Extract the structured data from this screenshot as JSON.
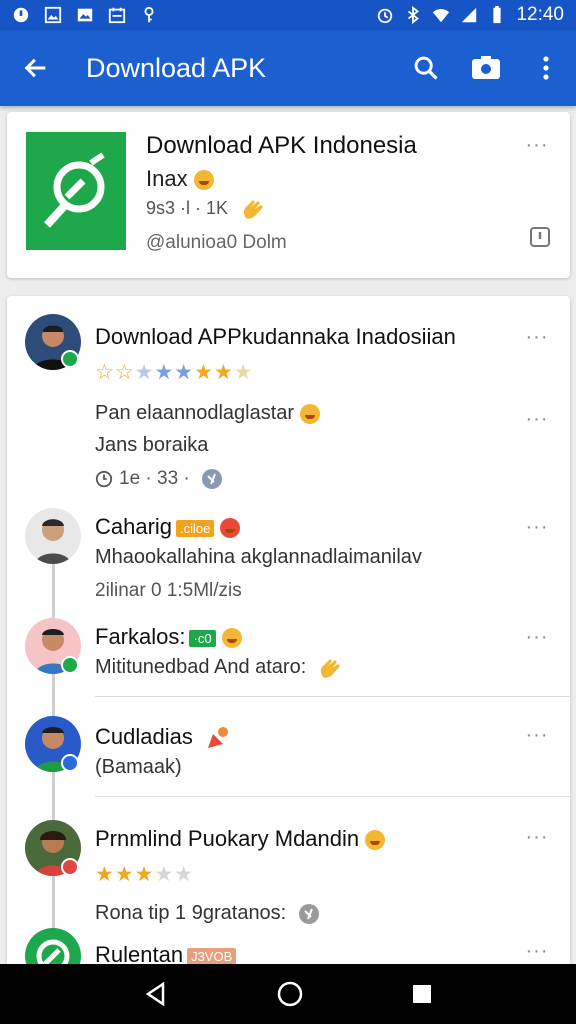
{
  "status_bar": {
    "time": "12:40"
  },
  "app_bar": {
    "title": "Download APK"
  },
  "header_card": {
    "title": "Download APK Indonesia",
    "subtitle": "Inax",
    "meta": "9s3 ·l · 1K",
    "source": "@alunioa0 Dolm"
  },
  "comments": [
    {
      "name": "Download APPkudannaka Inadosiian",
      "stars": "★★★★★★★★",
      "line1": "Pan elaannodlaglastar",
      "line2": "Jans boraika",
      "meta": "1e · 33 ·"
    },
    {
      "name": "Caharig",
      "tag": ".ciloe",
      "line1": "Mhaookallahina akglannadlaimanilav",
      "meta": "2ilinar 0 1:5Ml/zis"
    },
    {
      "name": "Farkalos:",
      "tag": "·c0",
      "line1": "Mititunedbad And ataro:"
    },
    {
      "name": "Cudladias",
      "line1": "(Bamaak)"
    },
    {
      "name": "Prnmlind Puokary Mdandin",
      "stars": "★★★★★",
      "line1": "Rona tip 1 9gratanos:"
    },
    {
      "name": "Rulentan",
      "tag": "J3VOB"
    }
  ],
  "colors": {
    "primary": "#1b5fd1",
    "status": "#1755c6",
    "app_icon": "#1ea84b",
    "star": "#f0a824"
  }
}
